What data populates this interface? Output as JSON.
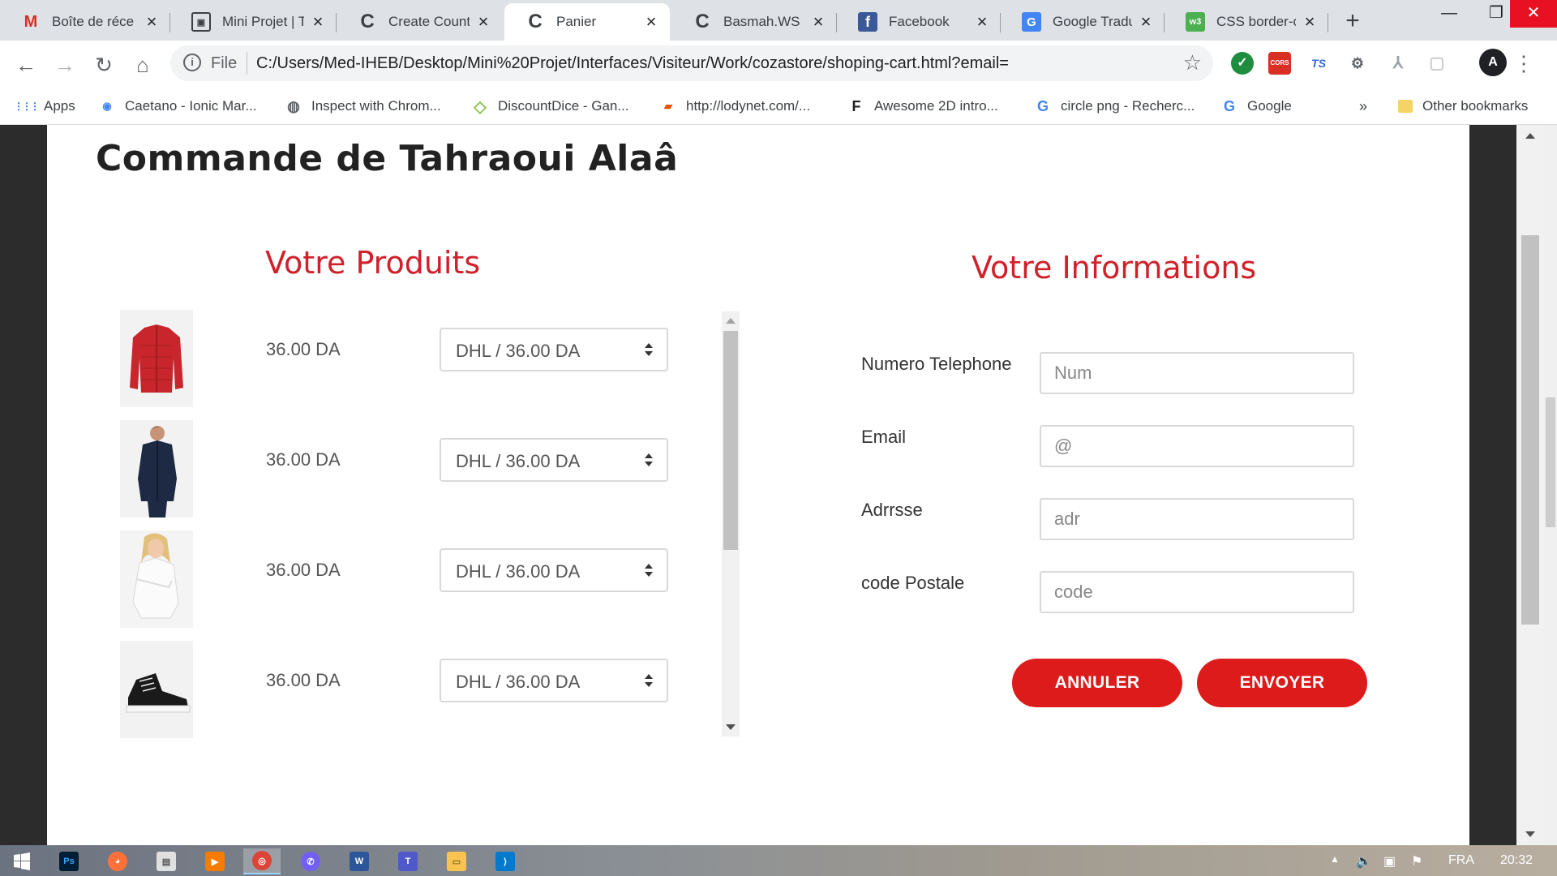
{
  "browser": {
    "tabs": [
      {
        "title": "Boîte de réce",
        "icon": "gmail-icon",
        "icon_glyph": "M",
        "icon_color": "#d93025",
        "active": false
      },
      {
        "title": "Mini Projet | T",
        "icon": "document-icon",
        "icon_glyph": "▣",
        "icon_color": "#3c4043",
        "active": false
      },
      {
        "title": "Create Count",
        "icon": "codepen-icon",
        "icon_glyph": "C",
        "icon_color": "#202124",
        "active": false
      },
      {
        "title": "Panier",
        "icon": "codepen-icon",
        "icon_glyph": "C",
        "icon_color": "#202124",
        "active": true
      },
      {
        "title": "Basmah.WS",
        "icon": "codepen-icon",
        "icon_glyph": "C",
        "icon_color": "#202124",
        "active": false
      },
      {
        "title": "Facebook",
        "icon": "facebook-icon",
        "icon_glyph": "f",
        "icon_color": "#3b5998",
        "active": false
      },
      {
        "title": "Google Tradu",
        "icon": "google-translate-icon",
        "icon_glyph": "G",
        "icon_color": "#4285f4",
        "active": false
      },
      {
        "title": "CSS border-c",
        "icon": "w3schools-icon",
        "icon_glyph": "w3",
        "icon_color": "#4caf50",
        "active": false
      }
    ],
    "new_tab_label": "+",
    "url_scheme_label": "File",
    "url": "C:/Users/Med-IHEB/Desktop/Mini%20Projet/Interfaces/Visiteur/Work/cozastore/shoping-cart.html?email=",
    "extensions": [
      {
        "name": "check-extension-icon",
        "label": "✓",
        "color": "#1e8e3e"
      },
      {
        "name": "cors-extension-icon",
        "label": "CORS",
        "color": "#d93025"
      },
      {
        "name": "ts-extension-icon",
        "label": "TS",
        "color": "#3367d6"
      },
      {
        "name": "gear-extension-icon",
        "label": "⚙",
        "color": "#9aa0a6"
      },
      {
        "name": "pdf-extension-icon",
        "label": "⅄",
        "color": "#9aa0a6"
      },
      {
        "name": "clipboard-extension-icon",
        "label": "▢",
        "color": "#c8cbcf"
      }
    ],
    "bookmarks": [
      {
        "label": "Apps",
        "icon": "apps-grid-icon",
        "glyph": "⋮⋮",
        "color": "#1a73e8"
      },
      {
        "label": "Caetano - Ionic Mar...",
        "icon": "bookmark-page-icon",
        "glyph": "◉",
        "color": "#4285f4"
      },
      {
        "label": "Inspect with Chrom...",
        "icon": "globe-icon",
        "glyph": "◍",
        "color": "#5f6368"
      },
      {
        "label": "DiscountDice - Gan...",
        "icon": "diamond-icon",
        "glyph": "◇",
        "color": "#8bc34a"
      },
      {
        "label": "http://lodynet.com/...",
        "icon": "lodynet-icon",
        "glyph": "▰",
        "color": "#e65100"
      },
      {
        "label": "Awesome 2D intro...",
        "icon": "flag-logo-icon",
        "glyph": "F",
        "color": "#202124"
      },
      {
        "label": "circle png - Recherc...",
        "icon": "google-icon",
        "glyph": "G",
        "color": "#4285f4"
      },
      {
        "label": "Google",
        "icon": "google-icon",
        "glyph": "G",
        "color": "#4285f4"
      }
    ],
    "bookmarks_overflow": "»",
    "other_bookmarks": "Other bookmarks"
  },
  "page": {
    "order_title": "Commande de Tahraoui Alaâ",
    "products_title": "Votre Produits",
    "info_title": "Votre Informations",
    "products": [
      {
        "price": "36.00 DA",
        "shipping": "DHL / 36.00 DA",
        "image": "red-jacket-image"
      },
      {
        "price": "36.00 DA",
        "shipping": "DHL / 36.00 DA",
        "image": "navy-jacket-man-image"
      },
      {
        "price": "36.00 DA",
        "shipping": "DHL / 36.00 DA",
        "image": "white-shirt-woman-image"
      },
      {
        "price": "36.00 DA",
        "shipping": "DHL / 36.00 DA",
        "image": "black-sneaker-image"
      }
    ],
    "form": {
      "phone": {
        "label": "Numero Telephone",
        "placeholder": "Num",
        "value": ""
      },
      "email": {
        "label": "Email",
        "placeholder": "@",
        "value": ""
      },
      "address": {
        "label": "Adrrsse",
        "placeholder": "adr",
        "value": ""
      },
      "postal": {
        "label": "code Postale",
        "placeholder": "code",
        "value": ""
      }
    },
    "cancel_label": "ANNULER",
    "send_label": "ENVOYER"
  },
  "taskbar": {
    "apps": [
      {
        "name": "photoshop-icon",
        "label": "Ps",
        "color": "#001e36"
      },
      {
        "name": "firefox-icon",
        "label": "◕",
        "color": "#ff7139"
      },
      {
        "name": "file-icon",
        "label": "▤",
        "color": "#e0e0e0"
      },
      {
        "name": "media-player-icon",
        "label": "▶",
        "color": "#f57c00"
      },
      {
        "name": "chrome-icon",
        "label": "◎",
        "color": "#db4437"
      },
      {
        "name": "viber-icon",
        "label": "✆",
        "color": "#7360f2"
      },
      {
        "name": "word-icon",
        "label": "W",
        "color": "#2b579a"
      },
      {
        "name": "teams-icon",
        "label": "T",
        "color": "#5059c9"
      },
      {
        "name": "file-explorer-icon",
        "label": "▭",
        "color": "#f8c44f"
      },
      {
        "name": "vscode-icon",
        "label": "⟩",
        "color": "#007acc"
      }
    ],
    "language": "FRA",
    "time": "20:32"
  },
  "colors": {
    "accent_red": "#dd1b1b",
    "section_title_red": "#d0212b"
  }
}
